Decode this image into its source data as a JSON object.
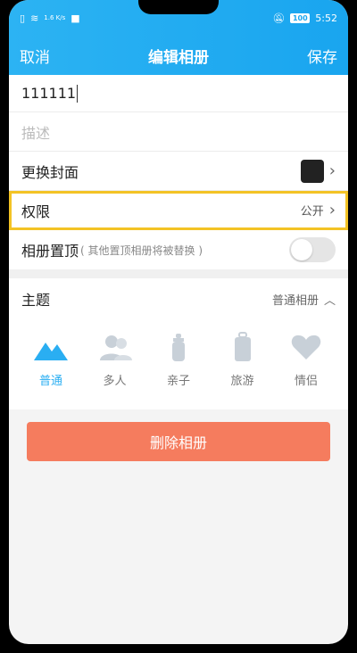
{
  "status": {
    "net_speed": "1.6 K/s",
    "battery": "100",
    "time": "5:52"
  },
  "nav": {
    "cancel": "取消",
    "title": "编辑相册",
    "save": "保存"
  },
  "form": {
    "name_value": "111111",
    "description_placeholder": "描述",
    "cover_label": "更换封面",
    "permission_label": "权限",
    "permission_value": "公开",
    "pin_label": "相册置顶",
    "pin_note": "( 其他置顶相册将被替换 )"
  },
  "theme": {
    "label": "主题",
    "selected": "普通相册",
    "options": [
      {
        "label": "普通",
        "icon": "mountain-icon"
      },
      {
        "label": "多人",
        "icon": "people-icon"
      },
      {
        "label": "亲子",
        "icon": "baby-bottle-icon"
      },
      {
        "label": "旅游",
        "icon": "suitcase-icon"
      },
      {
        "label": "情侣",
        "icon": "heart-icon"
      }
    ]
  },
  "delete_label": "删除相册",
  "colors": {
    "accent": "#2aaef2",
    "highlight_border": "#f3c325",
    "delete_button": "#f57c5e"
  }
}
